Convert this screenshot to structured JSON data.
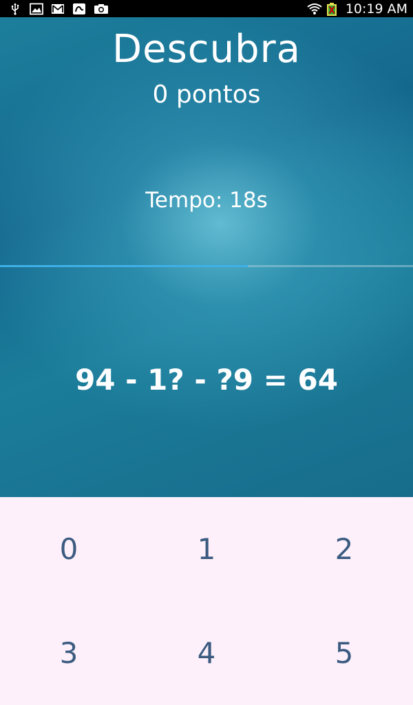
{
  "status_bar": {
    "time": "10:19 AM",
    "left_icons": [
      "usb-icon",
      "gallery-icon",
      "gmail-icon",
      "app-icon",
      "camera-icon"
    ],
    "right_icons": [
      "wifi-icon",
      "battery-icon"
    ]
  },
  "game": {
    "title": "Descubra",
    "score": "0 pontos",
    "timer": "Tempo: 18s",
    "progress": 0.6,
    "equation": "94 - 1? - ?9 = 64"
  },
  "keypad": {
    "keys": [
      "0",
      "1",
      "2",
      "3",
      "4",
      "5"
    ]
  },
  "colors": {
    "background_top": "#14688e",
    "keypad_bg": "#fdf0fa",
    "key_text": "#3a5a80",
    "progress_fill": "#3fb0e6"
  }
}
